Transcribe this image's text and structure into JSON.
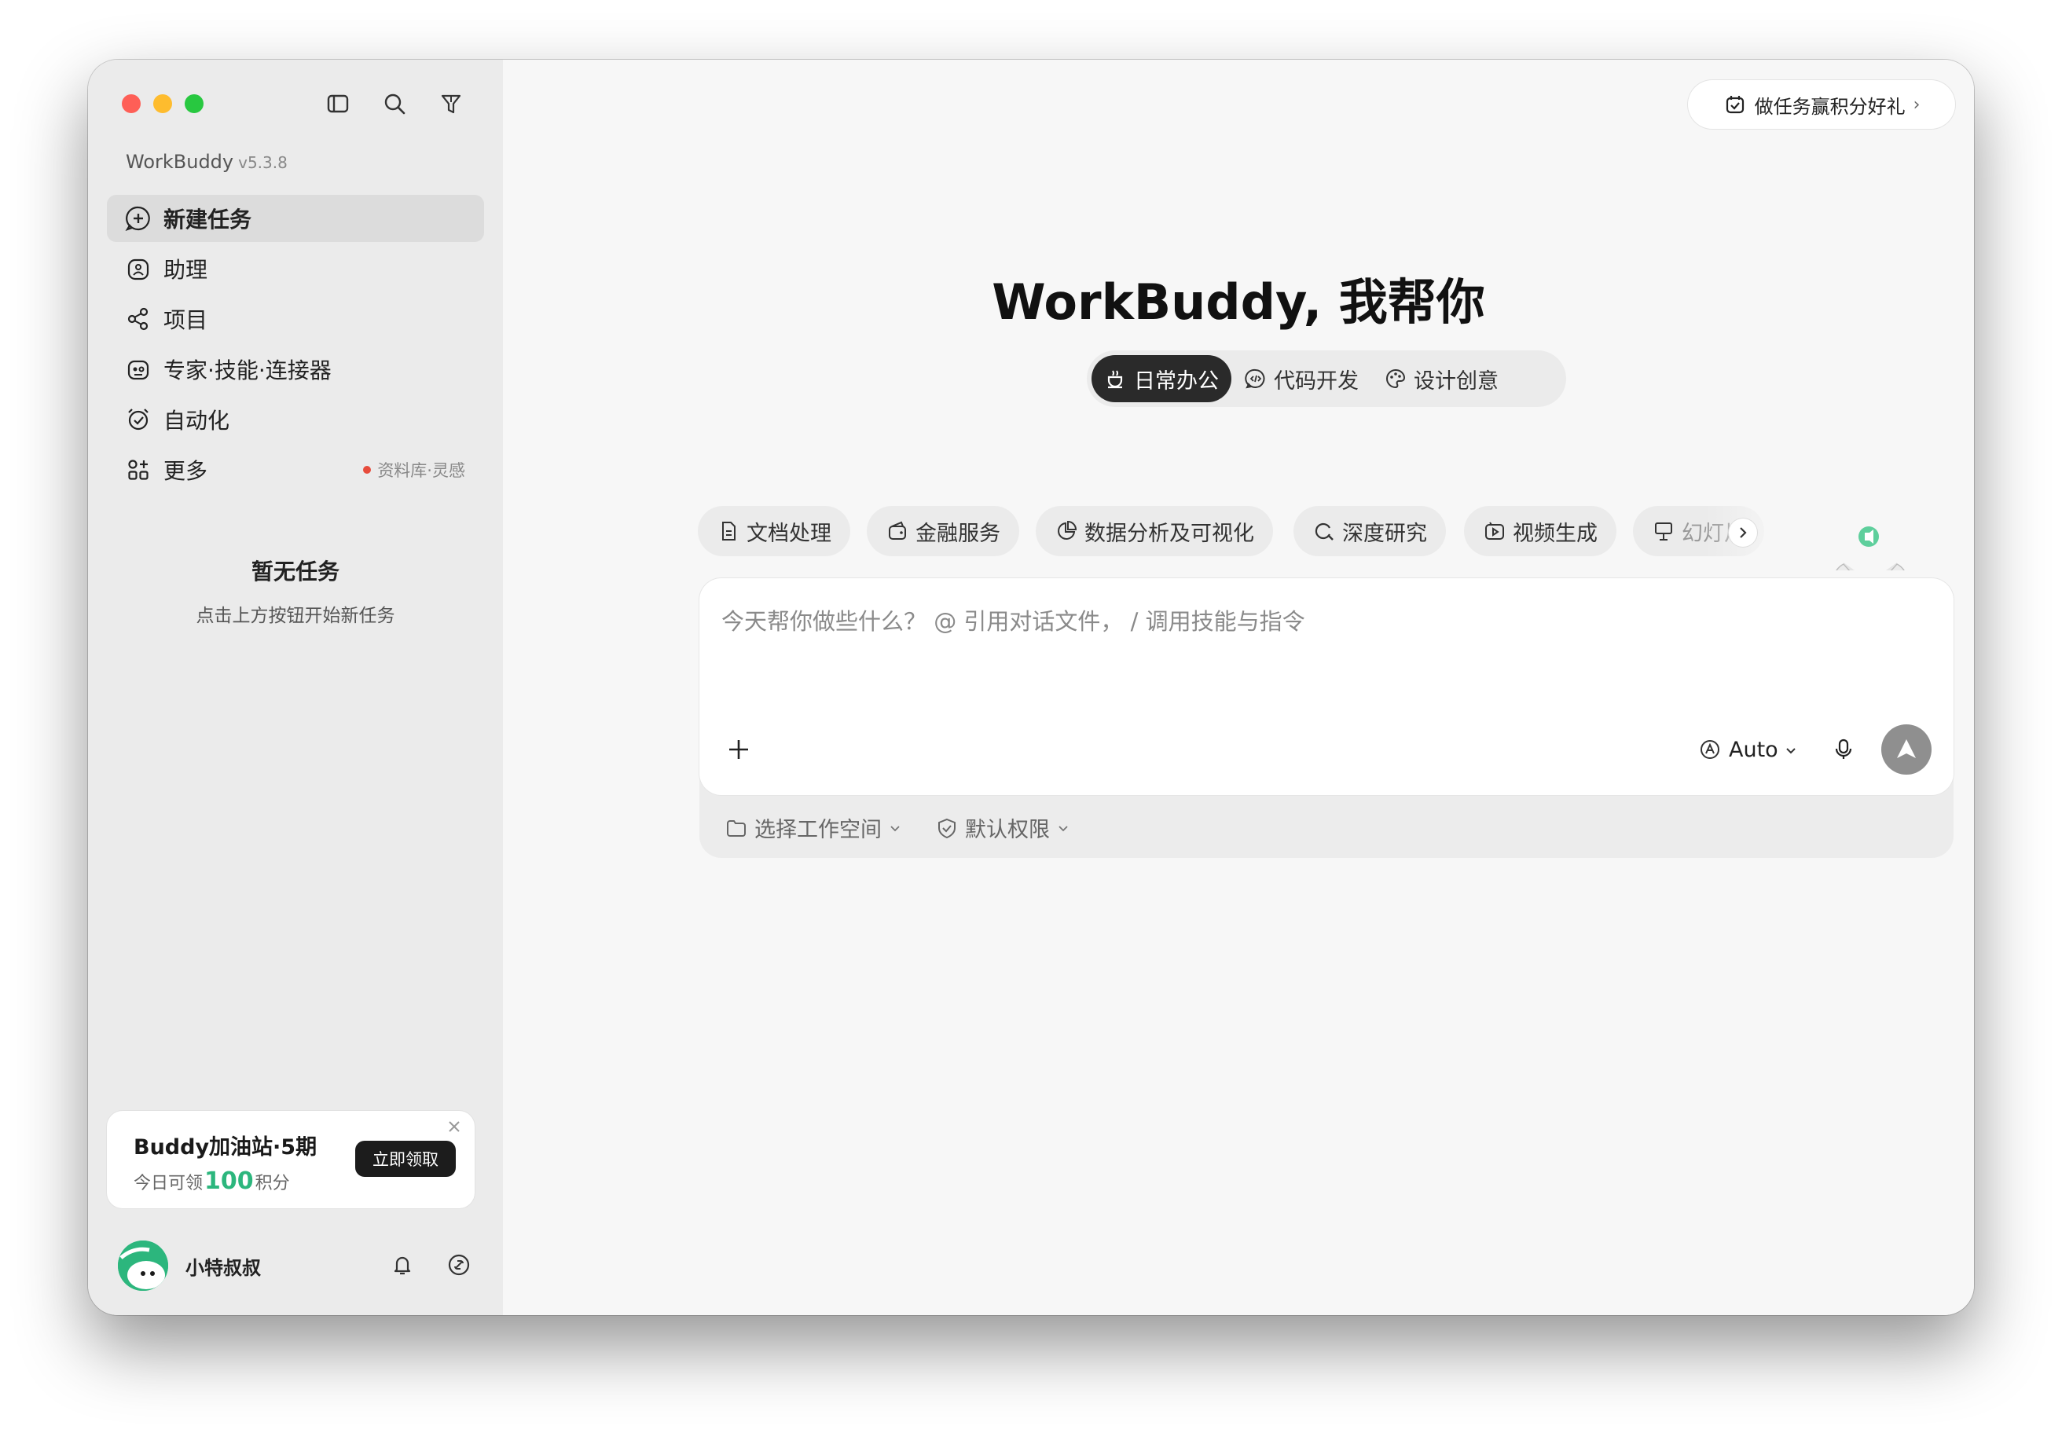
{
  "app": {
    "name": "WorkBuddy",
    "version": "v5.3.8"
  },
  "sidebar": {
    "items": [
      {
        "label": "新建任务",
        "icon": "plus-circle-icon",
        "active": true
      },
      {
        "label": "助理",
        "icon": "assistant-icon"
      },
      {
        "label": "项目",
        "icon": "project-icon"
      },
      {
        "label": "专家·技能·连接器",
        "icon": "expert-icon"
      },
      {
        "label": "自动化",
        "icon": "alarm-clock-icon"
      },
      {
        "label": "更多",
        "icon": "grid-plus-icon",
        "hint": "资料库·灵感"
      }
    ],
    "empty": {
      "title": "暂无任务",
      "subtitle": "点击上方按钮开始新任务"
    },
    "promo": {
      "title": "Buddy加油站·5期",
      "sub_prefix": "今日可领",
      "sub_number": "100",
      "sub_suffix": "积分",
      "button": "立即领取"
    },
    "user": {
      "name": "小特叔叔"
    }
  },
  "main": {
    "task_button": "做任务赢积分好礼",
    "hero": "WorkBuddy, 我帮你",
    "tabs": [
      {
        "label": "日常办公",
        "icon": "coffee-icon",
        "active": true
      },
      {
        "label": "代码开发",
        "icon": "code-icon"
      },
      {
        "label": "设计创意",
        "icon": "palette-icon"
      }
    ],
    "chips": [
      {
        "label": "文档处理",
        "icon": "document-icon"
      },
      {
        "label": "金融服务",
        "icon": "wallet-icon"
      },
      {
        "label": "数据分析及可视化",
        "icon": "pie-chart-icon"
      },
      {
        "label": "深度研究",
        "icon": "search-refresh-icon"
      },
      {
        "label": "视频生成",
        "icon": "video-icon"
      },
      {
        "label": "幻灯片",
        "icon": "presentation-icon"
      }
    ],
    "composer": {
      "placeholder": "今天帮你做些什么？ @ 引用对话文件， / 调用技能与指令",
      "model": "Auto"
    },
    "options": [
      {
        "label": "选择工作空间",
        "icon": "folder-icon"
      },
      {
        "label": "默认权限",
        "icon": "shield-check-icon"
      }
    ]
  },
  "colors": {
    "accent": "#2cb67d",
    "dark": "#2a2a2a",
    "sidebar_bg": "#ebebeb"
  }
}
